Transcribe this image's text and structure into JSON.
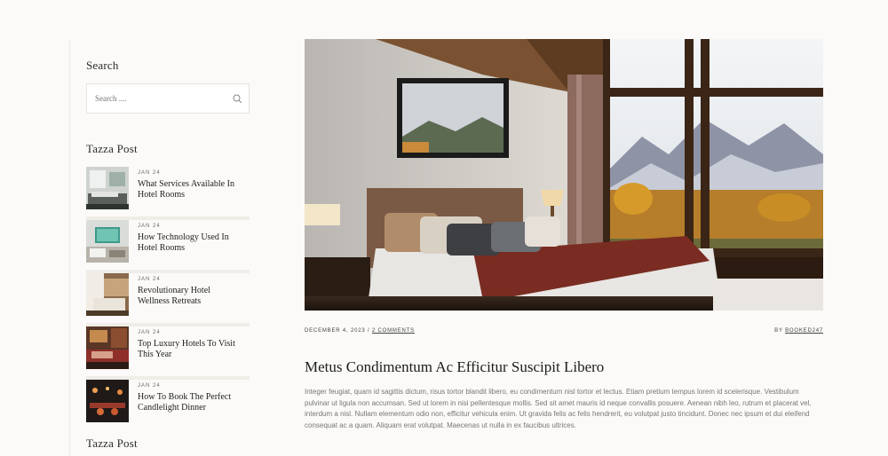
{
  "sidebar": {
    "search": {
      "title": "Search",
      "placeholder": "Search ...."
    },
    "posts": {
      "title": "Tazza Post",
      "items": [
        {
          "date": "JAN 24",
          "title": "What Services Available In Hotel Rooms"
        },
        {
          "date": "JAN 24",
          "title": "How Technology Used In Hotel Rooms"
        },
        {
          "date": "JAN 24",
          "title": "Revolutionary Hotel Wellness Retreats"
        },
        {
          "date": "JAN 24",
          "title": "Top Luxury Hotels To Visit This Year"
        },
        {
          "date": "JAN 24",
          "title": "How To Book The Perfect Candlelight Dinner"
        }
      ]
    },
    "next_widget_title": "Tazza Post"
  },
  "article": {
    "meta": {
      "date": "DECEMBER 4, 2023",
      "separator": "/",
      "comments": "2 COMMENTS",
      "author_prefix": "BY",
      "author": "BOOKED247"
    },
    "title": "Metus Condimentum Ac Efficitur Suscipit Libero",
    "excerpt": "Integer feugiat, quam id sagittis dictum, risus tortor blandit libero, eu condimentum nisl tortor et lectus. Etiam pretium tempus lorem id scelerisque. Vestibulum pulvinar ut ligula non accumsan. Sed ut lorem in nisi pellentesque mollis. Sed sit amet mauris id neque convallis posuere. Aenean nibh leo, rutrum et placerat vel, interdum a nisl. Nullam elementum odio non, efficitur vehicula enim. Ut gravida felis ac felis hendrerit, eu volutpat justo tincidunt. Donec nec ipsum et dui eleifend consequat ac a quam. Aliquam erat volutpat. Maecenas ut nulla in ex faucibus ultrices."
  },
  "colors": {
    "background": "#fbfaf8",
    "text": "#222222",
    "muted": "#777777"
  }
}
